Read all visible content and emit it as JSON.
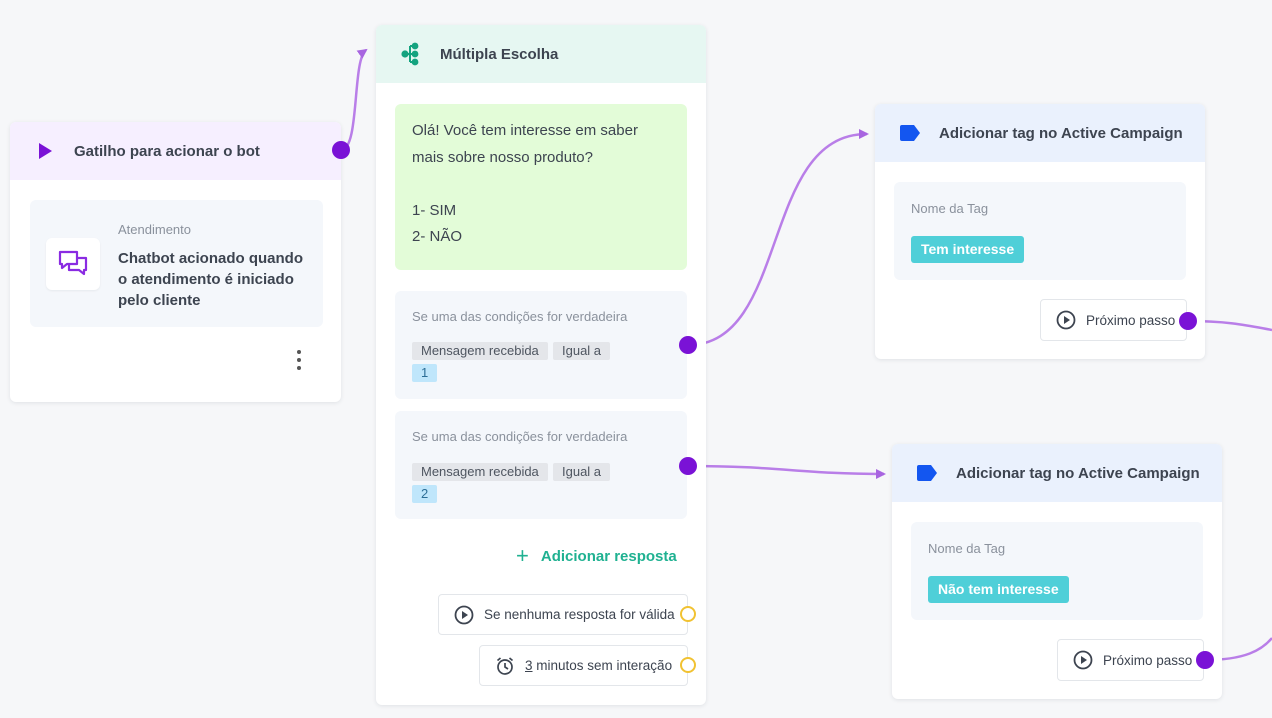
{
  "trigger": {
    "title": "Gatilho para acionar o bot",
    "card_label": "Atendimento",
    "card_description": "Chatbot acionado quando o atendimento é iniciado pelo cliente"
  },
  "choice": {
    "title": "Múltipla Escolha",
    "message": "Olá! Você tem interesse em saber mais sobre nosso produto?\n\n1- SIM\n2- NÃO",
    "conditions": [
      {
        "title": "Se uma das condições for verdadeira",
        "field": "Mensagem recebida",
        "operator": "Igual a",
        "value": "1"
      },
      {
        "title": "Se uma das condições for verdadeira",
        "field": "Mensagem recebida",
        "operator": "Igual a",
        "value": "2"
      }
    ],
    "add_response_label": "Adicionar resposta",
    "no_valid_response_label": "Se nenhuma resposta for válida",
    "timeout_number": "3",
    "timeout_label": " minutos sem interação"
  },
  "tags": [
    {
      "title": "Adicionar tag no Active Campaign",
      "field_label": "Nome da Tag",
      "tag_value": "Tem interesse",
      "next_label": "Próximo passo"
    },
    {
      "title": "Adicionar tag no Active Campaign",
      "field_label": "Nome da Tag",
      "tag_value": "Não tem interesse",
      "next_label": "Próximo passo"
    }
  ],
  "colors": {
    "connector": "#a865e0",
    "port": "#7a12d6",
    "fallback_port": "#f1c232",
    "tag_pill": "#4fcfd8",
    "accent_green": "#1fb191",
    "tag_icon": "#1356f0"
  },
  "icons": [
    "play-icon",
    "chat-icon",
    "more-vertical-icon",
    "branch-icon",
    "tag-icon",
    "plus-icon",
    "play-circle-icon",
    "alarm-clock-icon"
  ]
}
